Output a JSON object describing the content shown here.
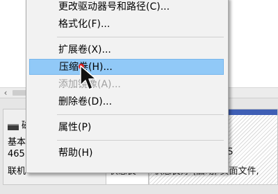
{
  "disk": {
    "label_1": "基本",
    "label_2": "465",
    "label_3": "联机",
    "title_partial": "磁"
  },
  "partitions": {
    "p1_status": "状态良",
    "p2_status": "状态良好 (启动, 页面文件,",
    "p2_fs_partial": "S"
  },
  "context_menu": {
    "items": [
      {
        "label": "更改驱动器号和路径(C)...",
        "disabled": false
      },
      {
        "label": "格式化(F)...",
        "disabled": false
      },
      {
        "label": "扩展卷(X)...",
        "disabled": false
      },
      {
        "label": "压缩卷(H)...",
        "disabled": false,
        "highlighted": true
      },
      {
        "label": "添加镜像(A)...",
        "disabled": true
      },
      {
        "label": "删除卷(D)...",
        "disabled": false
      },
      {
        "label": "属性(P)",
        "disabled": false
      },
      {
        "label": "帮助(H)",
        "disabled": false
      }
    ]
  },
  "colors": {
    "highlight": "#91c9f7",
    "partition_band": "#3f5fb5",
    "disabled_text": "#a0a0a0"
  },
  "icons": {
    "scroll_left": "chevron-left-icon",
    "disk": "disk-icon",
    "cursor": "mouse-pointer-icon"
  }
}
